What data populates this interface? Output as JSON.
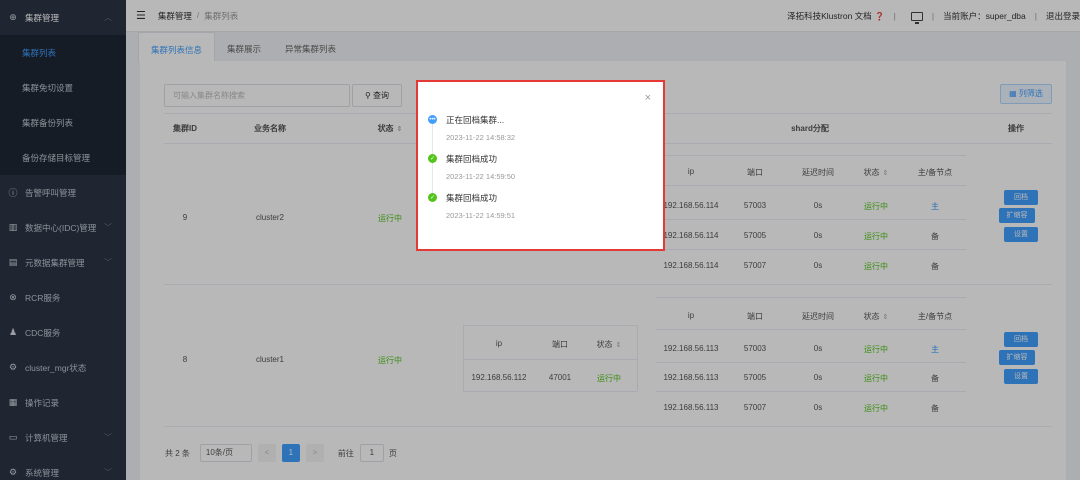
{
  "sidebar": {
    "group_title": "集群管理",
    "sub_items": [
      {
        "label": "集群列表"
      },
      {
        "label": "集群免切设置"
      },
      {
        "label": "集群备份列表"
      },
      {
        "label": "备份存储目标管理"
      }
    ],
    "items": [
      {
        "label": "告警呼叫管理"
      },
      {
        "label": "数据中心(IDC)管理"
      },
      {
        "label": "元数据集群管理"
      },
      {
        "label": "RCR服务"
      },
      {
        "label": "CDC服务"
      },
      {
        "label": "cluster_mgr状态"
      },
      {
        "label": "操作记录"
      },
      {
        "label": "计算机管理"
      },
      {
        "label": "系统管理"
      }
    ]
  },
  "topbar": {
    "breadcrumb_root": "集群管理",
    "breadcrumb_sep": "/",
    "breadcrumb_current": "集群列表",
    "docs": "泽拓科技Klustron 文档",
    "help_glyph": "❓",
    "divider": "|",
    "account": "当前账户：super_dba",
    "logout": "退出登录"
  },
  "tabs": [
    {
      "label": "集群列表信息"
    },
    {
      "label": "集群展示"
    },
    {
      "label": "异常集群列表"
    }
  ],
  "toolbar": {
    "search_placeholder": "可输入集群名称搜索",
    "query_label": "查询",
    "filter_label": "列筛选"
  },
  "table": {
    "headers": {
      "id": "集群ID",
      "name": "业务名称",
      "status": "状态",
      "shard": "shard分配",
      "op": "操作"
    },
    "sort_glyph": "⇕",
    "shard_headers": {
      "ip": "ip",
      "port": "端口",
      "delay": "延迟时间",
      "status": "状态",
      "role": "主/备节点"
    },
    "comp_headers": {
      "ip": "ip",
      "port": "端口",
      "status": "状态"
    },
    "rows": [
      {
        "id": "9",
        "name": "cluster2",
        "status": "运行中",
        "shards": [
          {
            "ip": "192.168.56.114",
            "port": "57003",
            "delay": "0s",
            "status": "运行中",
            "role": "主"
          },
          {
            "ip": "192.168.56.114",
            "port": "57005",
            "delay": "0s",
            "status": "运行中",
            "role": "备"
          },
          {
            "ip": "192.168.56.114",
            "port": "57007",
            "delay": "0s",
            "status": "运行中",
            "role": "备"
          }
        ],
        "buttons": [
          "回档",
          "扩缩容",
          "设置"
        ]
      },
      {
        "id": "8",
        "name": "cluster1",
        "status": "运行中",
        "comp": {
          "ip": "192.168.56.112",
          "port": "47001",
          "status": "运行中"
        },
        "shards": [
          {
            "ip": "192.168.56.113",
            "port": "57003",
            "delay": "0s",
            "status": "运行中",
            "role": "主"
          },
          {
            "ip": "192.168.56.113",
            "port": "57005",
            "delay": "0s",
            "status": "运行中",
            "role": "备"
          },
          {
            "ip": "192.168.56.113",
            "port": "57007",
            "delay": "0s",
            "status": "运行中",
            "role": "备"
          }
        ],
        "buttons": [
          "回档",
          "扩缩容",
          "设置"
        ]
      }
    ]
  },
  "pagination": {
    "total": "共 2 条",
    "page_size": "10条/页",
    "prev": "<",
    "current": "1",
    "next": ">",
    "goto_label": "前往",
    "goto_value": "1",
    "page_word": "页"
  },
  "dialog": {
    "close": "×",
    "timeline": [
      {
        "title": "正在回档集群...",
        "time": "2023-11-22 14:58:32",
        "state": "in-progress"
      },
      {
        "title": "集群回档成功",
        "time": "2023-11-22 14:59:50",
        "state": "success"
      },
      {
        "title": "集群回档成功",
        "time": "2023-11-22 14:59:51",
        "state": "success"
      }
    ]
  },
  "colors": {
    "accent": "#409eff",
    "success": "#52c41a",
    "highlight_border": "#e53935",
    "sidebar_bg": "#2b3444"
  }
}
